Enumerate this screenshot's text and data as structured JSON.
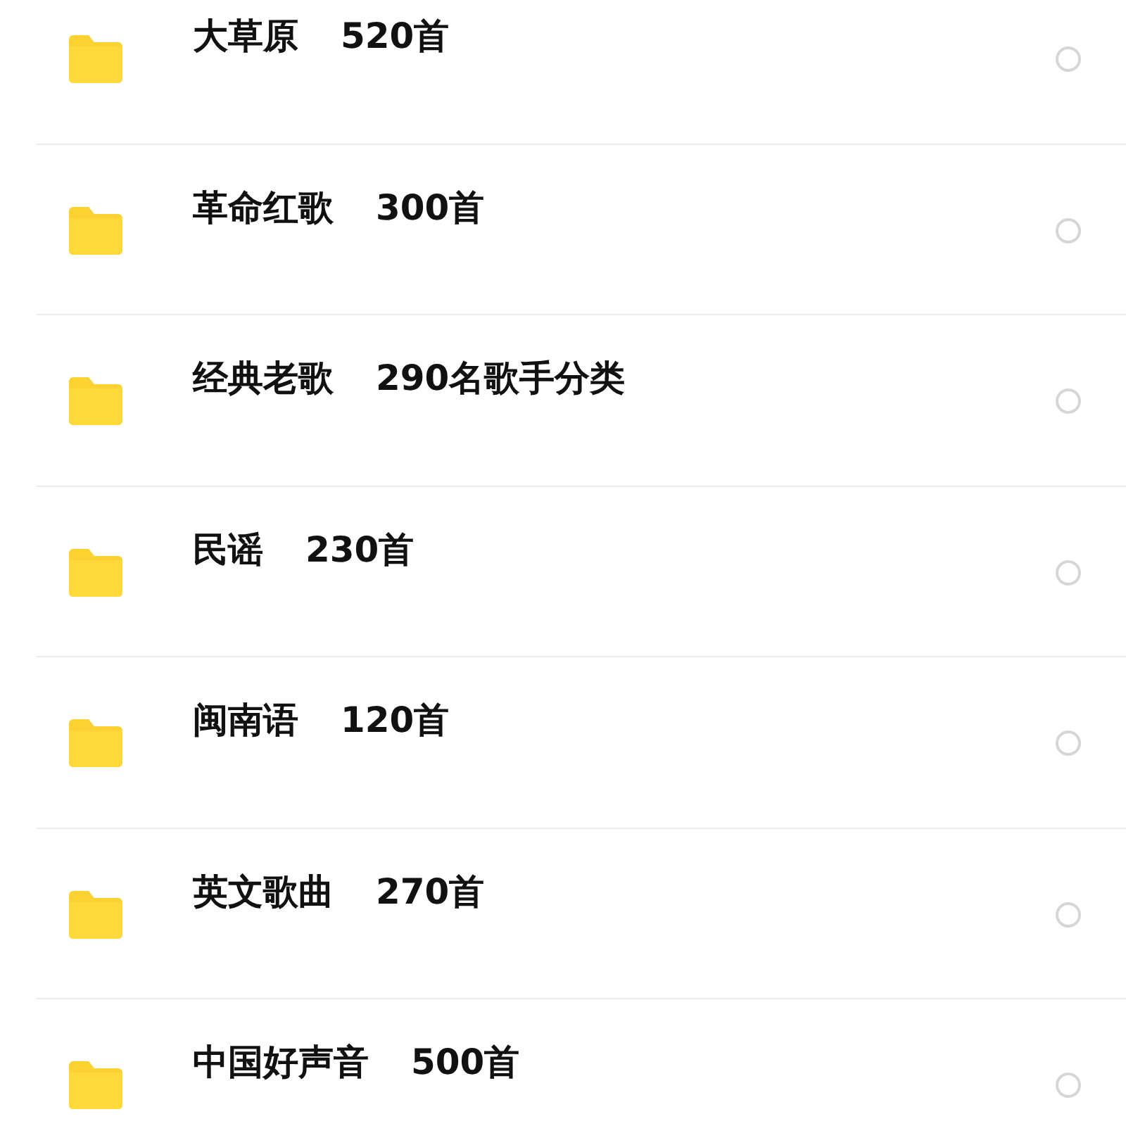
{
  "folders": [
    {
      "name": "大草原",
      "count": "520首",
      "selected": false
    },
    {
      "name": "革命红歌",
      "count": "300首",
      "selected": false
    },
    {
      "name": "经典老歌",
      "count": "290名歌手分类",
      "selected": false
    },
    {
      "name": "民谣",
      "count": "230首",
      "selected": false
    },
    {
      "name": "闽南语",
      "count": "120首",
      "selected": false
    },
    {
      "name": "英文歌曲",
      "count": "270首",
      "selected": false
    },
    {
      "name": "中国好声音",
      "count": "500首",
      "selected": false
    }
  ]
}
